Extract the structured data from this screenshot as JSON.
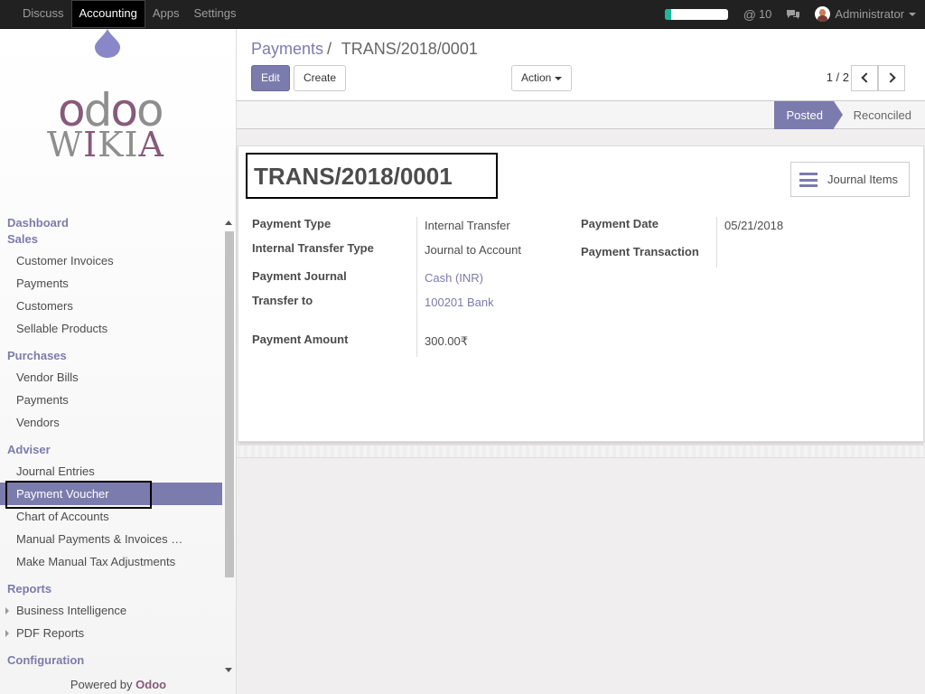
{
  "navbar": {
    "apps": [
      "Discuss",
      "Accounting",
      "Apps",
      "Settings"
    ],
    "active": "Accounting",
    "progress": 0.1,
    "message_count": "10",
    "user": "Administrator"
  },
  "sidebar": {
    "logo_text_top": "odoo",
    "logo_text_bottom": "WIKIA",
    "sections": [
      {
        "label": "Dashboard",
        "items": []
      },
      {
        "label": "Sales",
        "items": [
          "Customer Invoices",
          "Payments",
          "Customers",
          "Sellable Products"
        ]
      },
      {
        "label": "Purchases",
        "items": [
          "Vendor Bills",
          "Payments",
          "Vendors"
        ]
      },
      {
        "label": "Adviser",
        "items": [
          "Journal Entries",
          "Payment Voucher",
          "Chart of Accounts",
          "Manual Payments & Invoices …",
          "Make Manual Tax Adjustments"
        ]
      },
      {
        "label": "Reports",
        "items": [
          "Business Intelligence",
          "PDF Reports"
        ]
      },
      {
        "label": "Configuration",
        "items": []
      }
    ],
    "active_item": "Payment Voucher",
    "powered_prefix": "Powered by",
    "powered_brand": "Odoo"
  },
  "control_panel": {
    "breadcrumb_parent": "Payments",
    "breadcrumb_sep": "/",
    "breadcrumb_current": "TRANS/2018/0001",
    "edit_label": "Edit",
    "create_label": "Create",
    "action_label": "Action",
    "pager": "1 / 2"
  },
  "status": {
    "posted": "Posted",
    "reconciled": "Reconciled"
  },
  "form": {
    "title": "TRANS/2018/0001",
    "smart_button": "Journal Items",
    "payment_type_label": "Payment Type",
    "payment_type": "Internal Transfer",
    "internal_transfer_type_label": "Internal Transfer Type",
    "internal_transfer_type": "Journal to Account",
    "payment_journal_label": "Payment Journal",
    "payment_journal": "Cash (INR)",
    "transfer_to_label": "Transfer to",
    "transfer_to": "100201 Bank",
    "payment_amount_label": "Payment Amount",
    "payment_amount": "300.00₹",
    "payment_date_label": "Payment Date",
    "payment_date": "05/21/2018",
    "payment_transaction_label": "Payment Transaction",
    "payment_transaction": ""
  },
  "colors": {
    "primary": "#7c7bad",
    "brand": "#875a7b",
    "navbar": "#212121"
  }
}
